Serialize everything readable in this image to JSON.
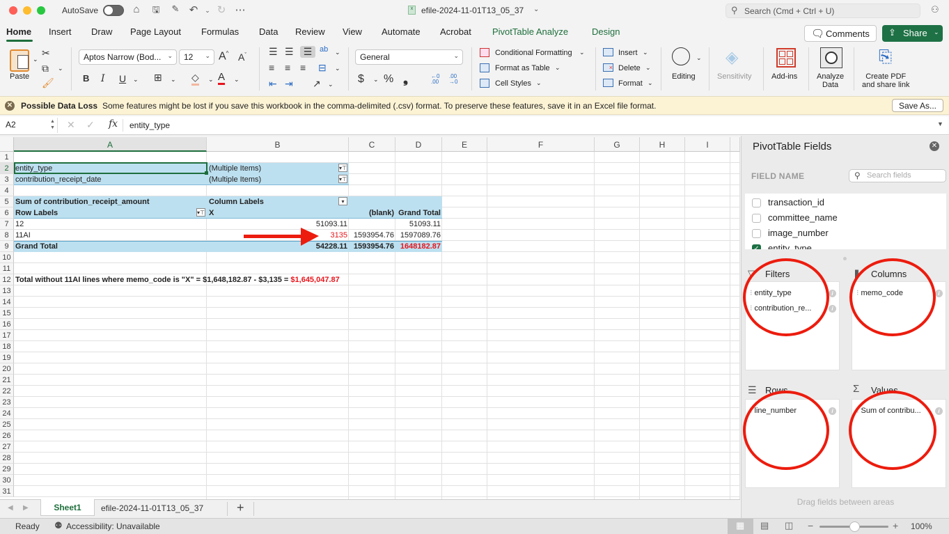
{
  "window": {
    "title": "efile-2024-11-01T13_05_37",
    "autosave_label": "AutoSave",
    "search_placeholder": "Search (Cmd + Ctrl + U)"
  },
  "ribbon_tabs": [
    "Home",
    "Insert",
    "Draw",
    "Page Layout",
    "Formulas",
    "Data",
    "Review",
    "View",
    "Automate",
    "Acrobat",
    "PivotTable Analyze",
    "Design"
  ],
  "header_buttons": {
    "comments": "Comments",
    "share": "Share"
  },
  "ribbon": {
    "paste": "Paste",
    "font_name": "Aptos Narrow (Bod...",
    "font_size": "12",
    "number_format": "General",
    "conditional_formatting": "Conditional Formatting",
    "format_as_table": "Format as Table",
    "cell_styles": "Cell Styles",
    "insert": "Insert",
    "delete": "Delete",
    "format": "Format",
    "editing": "Editing",
    "sensitivity": "Sensitivity",
    "addins": "Add-ins",
    "analyze_data_1": "Analyze",
    "analyze_data_2": "Data",
    "create_pdf_1": "Create PDF",
    "create_pdf_2": "and share link",
    "bold": "B",
    "italic": "I",
    "underline": "U",
    "currency": "$",
    "percent": "%",
    "comma": "❟"
  },
  "message_bar": {
    "title": "Possible Data Loss",
    "text": "Some features might be lost if you save this workbook in the comma-delimited (.csv) format. To preserve these features, save it in an Excel file format.",
    "button": "Save As..."
  },
  "formula_bar": {
    "name_box": "A2",
    "formula": "entity_type",
    "fx": "fx"
  },
  "columns": [
    "A",
    "B",
    "C",
    "D",
    "E",
    "F",
    "G",
    "H",
    "I"
  ],
  "rows": [
    "1",
    "2",
    "3",
    "4",
    "5",
    "6",
    "7",
    "8",
    "9",
    "10",
    "11",
    "12",
    "13",
    "14",
    "15",
    "16",
    "17",
    "18",
    "19",
    "20",
    "21",
    "22",
    "23",
    "24",
    "25",
    "26",
    "27",
    "28",
    "29",
    "30",
    "31"
  ],
  "pivot": {
    "filter1_label": "entity_type",
    "filter1_value": "(Multiple Items)",
    "filter2_label": "contribution_receipt_date",
    "filter2_value": "(Multiple Items)",
    "values_header": "Sum of contribution_receipt_amount",
    "column_labels": "Column Labels",
    "row_labels": "Row Labels",
    "col_x": "X",
    "col_blank": "(blank)",
    "col_grand": "Grand Total",
    "rows": [
      {
        "label": "12",
        "x": "51093.11",
        "blank": "",
        "total": "51093.11"
      },
      {
        "label": "11AI",
        "x": "3135",
        "blank": "1593954.76",
        "total": "1597089.76"
      }
    ],
    "grand_total": {
      "label": "Grand Total",
      "x": "54228.11",
      "blank": "1593954.76",
      "total": "1648182.87"
    }
  },
  "note": {
    "text": "Total without 11AI lines where memo_code is \"X\" = $1,648,182.87 - $3,135 = ",
    "result": "$1,645,047.87"
  },
  "sheets": {
    "tabs": [
      "Sheet1",
      "efile-2024-11-01T13_05_37"
    ],
    "active": "Sheet1"
  },
  "status": {
    "ready": "Ready",
    "accessibility": "Accessibility: Unavailable",
    "zoom": "100%",
    "zoom_level_percent": 100
  },
  "pivot_pane": {
    "title": "PivotTable Fields",
    "field_name_header": "FIELD NAME",
    "search_placeholder": "Search fields",
    "fields": [
      {
        "name": "transaction_id",
        "checked": false
      },
      {
        "name": "committee_name",
        "checked": false
      },
      {
        "name": "image_number",
        "checked": false
      },
      {
        "name": "entity_type",
        "checked": true
      }
    ],
    "areas": {
      "filters": {
        "label": "Filters",
        "items": [
          "entity_type",
          "contribution_re..."
        ]
      },
      "columns": {
        "label": "Columns",
        "items": [
          "memo_code"
        ]
      },
      "rows": {
        "label": "Rows",
        "items": [
          "line_number"
        ]
      },
      "values": {
        "label": "Values",
        "items": [
          "Sum of contribu..."
        ]
      }
    },
    "drag_hint": "Drag fields between areas"
  },
  "colors": {
    "accent_green": "#1e6e3c",
    "pivot_blue": "#bde0f0",
    "annotation_red": "#ec1c0e",
    "highlight_red": "#e8141b"
  }
}
